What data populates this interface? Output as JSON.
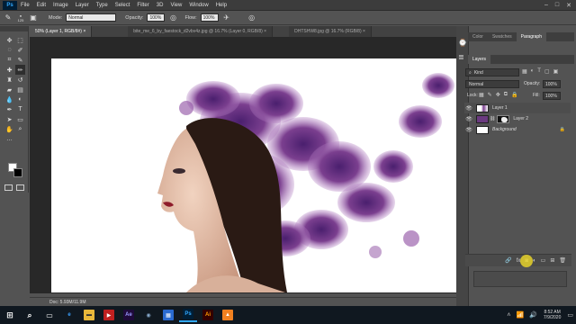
{
  "app": {
    "logo": "Ps"
  },
  "menu": [
    "File",
    "Edit",
    "Image",
    "Layer",
    "Type",
    "Select",
    "Filter",
    "3D",
    "View",
    "Window",
    "Help"
  ],
  "window_controls": [
    "–",
    "□",
    "✕"
  ],
  "options_bar": {
    "brush_size": "125",
    "mode_label": "Mode:",
    "mode_value": "Normal",
    "opacity_label": "Opacity:",
    "opacity_value": "100%",
    "flow_label": "Flow:",
    "flow_value": "100%"
  },
  "doc_tabs": [
    {
      "label": "50% (Layer 1, RGB/8#) ×",
      "active": true
    },
    {
      "label": "bite_me_6_by_faestock_d2vbv4z.jpg @ 16.7% (Layer 0, RGB/8) ×",
      "active": false
    },
    {
      "label": "DHTSHW8.jpg @ 16.7% (RGB/8) ×",
      "active": false
    }
  ],
  "status": {
    "doc_size": "Doc: 5.93M/11.9M"
  },
  "right_panel": {
    "top_tabs": [
      "Color",
      "Swatches",
      "Paragraph"
    ],
    "active_top_tab": "Paragraph",
    "layers_tab": "Layers",
    "filter_kind": "Kind",
    "blend_mode": "Normal",
    "opacity_label": "Opacity:",
    "opacity_value": "100%",
    "lock_label": "Lock:",
    "fill_label": "Fill:",
    "fill_value": "100%",
    "layers": [
      {
        "name": "Layer 1",
        "selected": true,
        "has_mask": false,
        "locked": false
      },
      {
        "name": "Layer 2",
        "selected": false,
        "has_mask": true,
        "locked": false
      },
      {
        "name": "Background",
        "selected": false,
        "has_mask": false,
        "locked": true
      }
    ],
    "footer_icons": [
      "link-icon",
      "fx-icon",
      "mask-icon",
      "adjustment-icon",
      "folder-icon",
      "new-layer-icon",
      "trash-icon"
    ]
  },
  "taskbar": {
    "apps": [
      "Ae",
      "Ps",
      "Ai"
    ],
    "time": "8:52 AM",
    "date": "7/9/2020"
  },
  "colors": {
    "accent_ps": "#31a8ff",
    "ae": "#9999ff",
    "ai": "#ff9a00",
    "smoke": "#7b3f8f",
    "highlight": "#e5d12a"
  }
}
